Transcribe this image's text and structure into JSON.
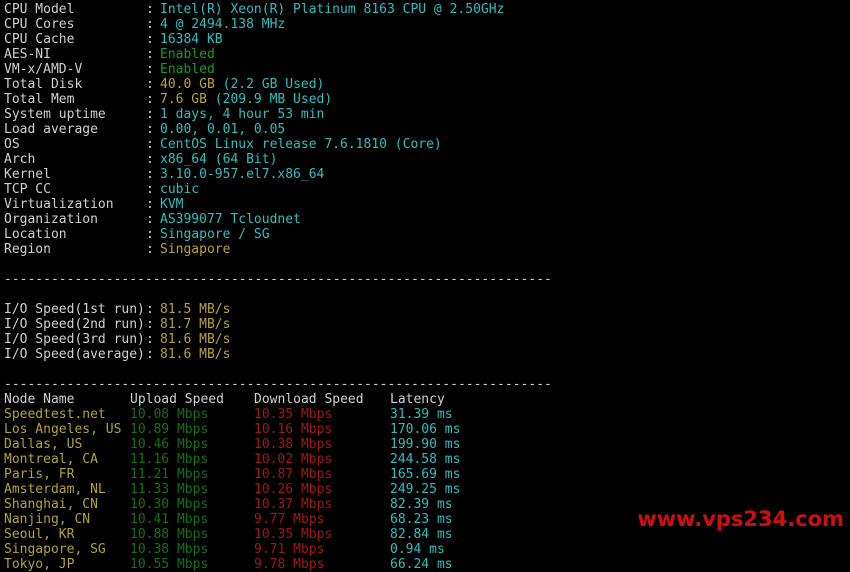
{
  "system_info": [
    {
      "label": "CPU Model",
      "value": "Intel(R) Xeon(R) Platinum 8163 CPU @ 2.50GHz",
      "color": "cyan"
    },
    {
      "label": "CPU Cores",
      "value": "4 @ 2494.138 MHz",
      "color": "cyan"
    },
    {
      "label": "CPU Cache",
      "value": "16384 KB",
      "color": "cyan"
    },
    {
      "label": "AES-NI",
      "value": "Enabled",
      "color": "green"
    },
    {
      "label": "VM-x/AMD-V",
      "value": "Enabled",
      "color": "green"
    },
    {
      "label": "Total Disk",
      "value": "40.0 GB",
      "extra": " (2.2 GB Used)",
      "color": "yellow"
    },
    {
      "label": "Total Mem",
      "value": "7.6 GB",
      "extra": " (209.9 MB Used)",
      "color": "yellow"
    },
    {
      "label": "System uptime",
      "value": "1 days, 4 hour 53 min",
      "color": "cyan"
    },
    {
      "label": "Load average",
      "value": "0.00, 0.01, 0.05",
      "color": "cyan"
    },
    {
      "label": "OS",
      "value": "CentOS Linux release 7.6.1810 (Core)",
      "color": "cyan"
    },
    {
      "label": "Arch",
      "value": "x86_64 (64 Bit)",
      "color": "cyan"
    },
    {
      "label": "Kernel",
      "value": "3.10.0-957.el7.x86_64",
      "color": "cyan"
    },
    {
      "label": "TCP CC",
      "value": "cubic",
      "color": "cyan"
    },
    {
      "label": "Virtualization",
      "value": "KVM",
      "color": "cyan"
    },
    {
      "label": "Organization",
      "value": "AS399077 Tcloudnet",
      "color": "cyan"
    },
    {
      "label": "Location",
      "value": "Singapore / SG",
      "color": "cyan"
    },
    {
      "label": "Region",
      "value": "Singapore",
      "color": "yellow"
    }
  ],
  "divider": "----------------------------------------------------------------------",
  "io_speed": [
    {
      "label": "I/O Speed(1st run)",
      "value": "81.5 MB/s"
    },
    {
      "label": "I/O Speed(2nd run)",
      "value": "81.7 MB/s"
    },
    {
      "label": "I/O Speed(3rd run)",
      "value": "81.6 MB/s"
    },
    {
      "label": "I/O Speed(average)",
      "value": "81.6 MB/s"
    }
  ],
  "speedtest": {
    "headers": {
      "node": "Node Name",
      "upload": "Upload Speed",
      "download": "Download Speed",
      "latency": "Latency"
    },
    "rows": [
      {
        "node": "Speedtest.net",
        "upload": "10.08 Mbps",
        "download": "10.35 Mbps",
        "latency": "31.39 ms"
      },
      {
        "node": "Los Angeles, US",
        "upload": "10.89 Mbps",
        "download": "10.16 Mbps",
        "latency": "170.06 ms"
      },
      {
        "node": "Dallas, US",
        "upload": "10.46 Mbps",
        "download": "10.38 Mbps",
        "latency": "199.90 ms"
      },
      {
        "node": "Montreal, CA",
        "upload": "11.16 Mbps",
        "download": "10.02 Mbps",
        "latency": "244.58 ms"
      },
      {
        "node": "Paris, FR",
        "upload": "11.21 Mbps",
        "download": "10.87 Mbps",
        "latency": "165.69 ms"
      },
      {
        "node": "Amsterdam, NL",
        "upload": "11.33 Mbps",
        "download": "10.26 Mbps",
        "latency": "249.25 ms"
      },
      {
        "node": "Shanghai, CN",
        "upload": "10.30 Mbps",
        "download": "10.37 Mbps",
        "latency": "82.39 ms"
      },
      {
        "node": "Nanjing, CN",
        "upload": "10.41 Mbps",
        "download": "9.77 Mbps",
        "latency": "68.23 ms"
      },
      {
        "node": "Seoul, KR",
        "upload": "10.88 Mbps",
        "download": "10.35 Mbps",
        "latency": "82.84 ms"
      },
      {
        "node": "Singapore, SG",
        "upload": "10.38 Mbps",
        "download": "9.71 Mbps",
        "latency": "0.94 ms"
      },
      {
        "node": "Tokyo, JP",
        "upload": "10.55 Mbps",
        "download": "9.78 Mbps",
        "latency": "66.24 ms"
      }
    ]
  },
  "watermark": "www.vps234.com",
  "colors": {
    "background": "#000000",
    "label": "#d0d0d0",
    "cyan": "#2fbfbf",
    "green": "#1d9a1d",
    "yellow": "#b8a13a",
    "upload": "#176f17",
    "download": "#a01818",
    "latency": "#2fbfbf",
    "node": "#b0a23c",
    "watermark": "#cc0f0f"
  }
}
